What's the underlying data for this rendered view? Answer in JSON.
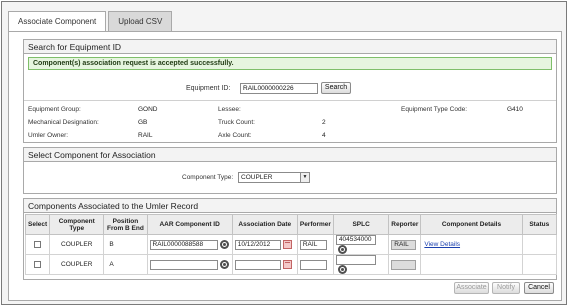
{
  "tabs": [
    {
      "label": "Associate Component",
      "active": true
    },
    {
      "label": "Upload CSV",
      "active": false
    }
  ],
  "search": {
    "title": "Search for Equipment ID",
    "success_message": "Component(s) association request is accepted successfully.",
    "equipment_id_label": "Equipment ID:",
    "equipment_id_value": "RAIL0000000226",
    "search_button": "Search"
  },
  "details": {
    "equipment_group_label": "Equipment Group:",
    "equipment_group": "GOND",
    "lessee_label": "Lessee:",
    "lessee": "",
    "equipment_type_code_label": "Equipment Type Code:",
    "equipment_type_code": "G410",
    "mechanical_designation_label": "Mechanical Designation:",
    "mechanical_designation": "GB",
    "truck_count_label": "Truck Count:",
    "truck_count": "2",
    "umler_owner_label": "Umler Owner:",
    "umler_owner": "RAIL",
    "axle_count_label": "Axle Count:",
    "axle_count": "4"
  },
  "select_component": {
    "title": "Select Component for Association",
    "component_type_label": "Component Type:",
    "component_type_value": "COUPLER"
  },
  "components": {
    "title": "Components Associated to the Umler Record",
    "columns": [
      "Select",
      "Component Type",
      "Position From B End",
      "AAR Component ID",
      "Association Date",
      "Performer",
      "SPLC",
      "Reporter",
      "Component Details",
      "Status"
    ],
    "rows": [
      {
        "component_type": "COUPLER",
        "position": "B",
        "aar_id": "RAIL0000088588",
        "date": "10/12/2012",
        "performer": "RAIL",
        "splc": "404534000",
        "reporter": "RAIL",
        "details_link": "View Details",
        "status": ""
      },
      {
        "component_type": "COUPLER",
        "position": "A",
        "aar_id": "",
        "date": "",
        "performer": "",
        "splc": "",
        "reporter": "",
        "details_link": "",
        "status": ""
      }
    ]
  },
  "footer": {
    "associate_button": "Associate",
    "notify_button": "Notify",
    "cancel_button": "Cancel"
  }
}
